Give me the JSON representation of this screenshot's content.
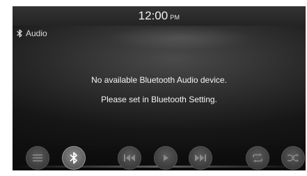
{
  "status_bar": {
    "time": "12:00",
    "ampm": "PM"
  },
  "source": {
    "label": "Audio",
    "icon": "bluetooth-icon"
  },
  "message": {
    "line1": "No available Bluetooth Audio device.",
    "line2": "Please set in Bluetooth Setting."
  },
  "controls": [
    {
      "name": "menu-button",
      "icon": "menu-icon",
      "state": "dimmed"
    },
    {
      "name": "bluetooth-button",
      "icon": "bluetooth-icon",
      "state": "active"
    },
    {
      "name": "previous-track-button",
      "icon": "previous-track-icon",
      "state": "dimmed"
    },
    {
      "name": "play-button",
      "icon": "play-icon",
      "state": "dimmed"
    },
    {
      "name": "next-track-button",
      "icon": "next-track-icon",
      "state": "dimmed"
    },
    {
      "name": "repeat-button",
      "icon": "repeat-icon",
      "state": "dimmed"
    },
    {
      "name": "shuffle-button",
      "icon": "shuffle-icon",
      "state": "dimmed"
    }
  ],
  "colors": {
    "background": "#161616",
    "text": "#f5f5f5",
    "button_dim": "#3c3c3c",
    "button_active": "#6a6a6a"
  }
}
